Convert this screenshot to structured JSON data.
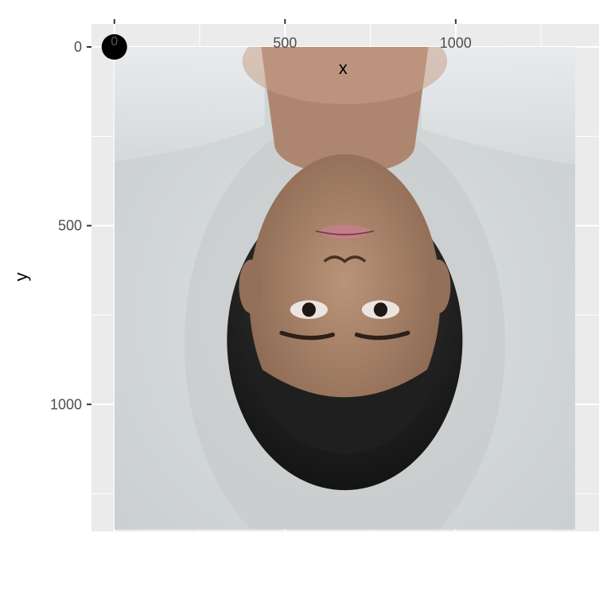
{
  "chart_data": {
    "type": "scatter",
    "title": "",
    "xlabel": "x",
    "ylabel": "y",
    "x_axis_position": "top",
    "y_reversed": true,
    "xlim": [
      -67,
      1420
    ],
    "ylim": [
      0,
      1420
    ],
    "x_ticks": [
      0,
      500,
      1000
    ],
    "y_ticks": [
      0,
      500,
      1000
    ],
    "x_tick_labels": [
      "0",
      "500",
      "1000"
    ],
    "y_tick_labels": [
      "0",
      "500",
      "1000"
    ],
    "grid": true,
    "legend": "none",
    "raster_image": {
      "description": "portrait photograph shown upside down",
      "x_range": [
        0,
        1350
      ],
      "y_range": [
        0,
        1350
      ]
    },
    "points": [
      {
        "x": 0,
        "y": 0,
        "label": "0"
      }
    ]
  },
  "colors": {
    "panel_background": "#ebebeb",
    "grid_major": "#ffffff",
    "grid_minor": "#f5f5f5",
    "tick_text": "#4d4d4d",
    "axis_title": "#000000",
    "point": "#000000",
    "photo_background": "#d4d8d8",
    "skin": "#b48e74",
    "hair": "#2a2a2a",
    "lips": "#c37f86"
  }
}
